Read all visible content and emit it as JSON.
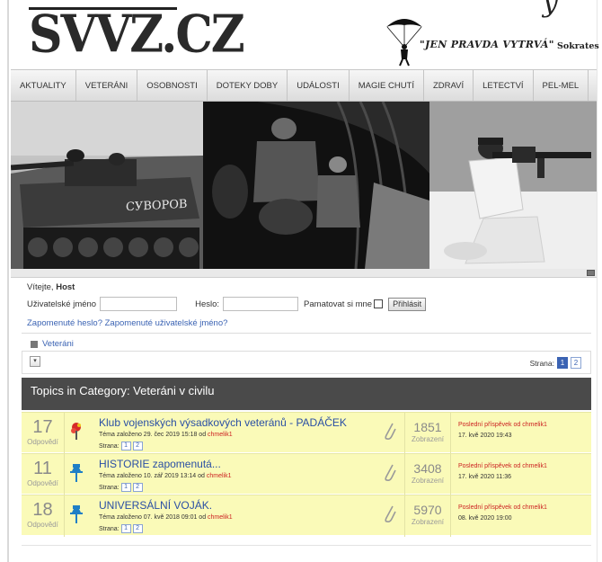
{
  "header": {
    "logo": "SVVZ.CZ",
    "motto": "\"JEN PRAVDA VYTRVÁ\"",
    "motto_author": "Sokrates",
    "corner_glyph": "y"
  },
  "nav": {
    "items": [
      {
        "label": "AKTUALITY"
      },
      {
        "label": "VETERÁNI"
      },
      {
        "label": "OSOBNOSTI"
      },
      {
        "label": "DOTEKY DOBY"
      },
      {
        "label": "UDÁLOSTI"
      },
      {
        "label": "MAGIE CHUTÍ"
      },
      {
        "label": "ZDRAVÍ"
      },
      {
        "label": "LETECTVÍ"
      },
      {
        "label": "PEL-MEL"
      }
    ]
  },
  "banner": {
    "tank_text": "СУВОРОВ"
  },
  "login": {
    "welcome_prefix": "Vítejte, ",
    "welcome_user": "Host",
    "username_label": "Uživatelské jméno",
    "username_value": "",
    "password_label": "Heslo:",
    "password_value": "",
    "remember_label": "Pamatovat si mne",
    "login_button": "Přihlásit",
    "forgot_password": "Zapomenuté heslo?",
    "forgot_username": "Zapomenuté uživatelské jméno?"
  },
  "breadcrumb": {
    "label": "Veteráni"
  },
  "pager": {
    "label": "Strana:",
    "pages": [
      "1",
      "2"
    ],
    "active": "1"
  },
  "category": {
    "title": "Topics in Category: Veteráni v civilu"
  },
  "topics": [
    {
      "replies": "17",
      "replies_label": "Odpovědí",
      "title": "Klub vojenských výsadkových veteránů - PADÁČEK",
      "meta_prefix": "Téma založeno 29. čec 2019 15:18 od ",
      "author": "chmelik1",
      "pages_label": "Strana:",
      "pages": [
        "1",
        "2"
      ],
      "views": "1851",
      "views_label": "Zobrazení",
      "last_label": "Poslední příspěvek od ",
      "last_user": "chmelik1",
      "last_date": "17. kvě 2020 19:43",
      "icon": "hot-topic-icon",
      "icon_color": "#d62a2a"
    },
    {
      "replies": "11",
      "replies_label": "Odpovědí",
      "title": "HISTORIE zapomenutá...",
      "meta_prefix": "Téma založeno 10. zář 2019 13:14 od ",
      "author": "chmelik1",
      "pages_label": "Strana:",
      "pages": [
        "1",
        "2"
      ],
      "views": "3408",
      "views_label": "Zobrazení",
      "last_label": "Poslední příspěvek od ",
      "last_user": "chmelik1",
      "last_date": "17. kvě 2020 11:36",
      "icon": "pin-icon",
      "icon_color": "#1f7fc6"
    },
    {
      "replies": "18",
      "replies_label": "Odpovědí",
      "title": "UNIVERSÁLNÍ VOJÁK.",
      "meta_prefix": "Téma založeno 07. kvě 2018 09:01 od ",
      "author": "chmelik1",
      "pages_label": "Strana:",
      "pages": [
        "1",
        "2"
      ],
      "views": "5970",
      "views_label": "Zobrazení",
      "last_label": "Poslední příspěvek od ",
      "last_user": "chmelik1",
      "last_date": "08. kvě 2020 19:00",
      "icon": "pin-icon",
      "icon_color": "#1f7fc6"
    }
  ]
}
